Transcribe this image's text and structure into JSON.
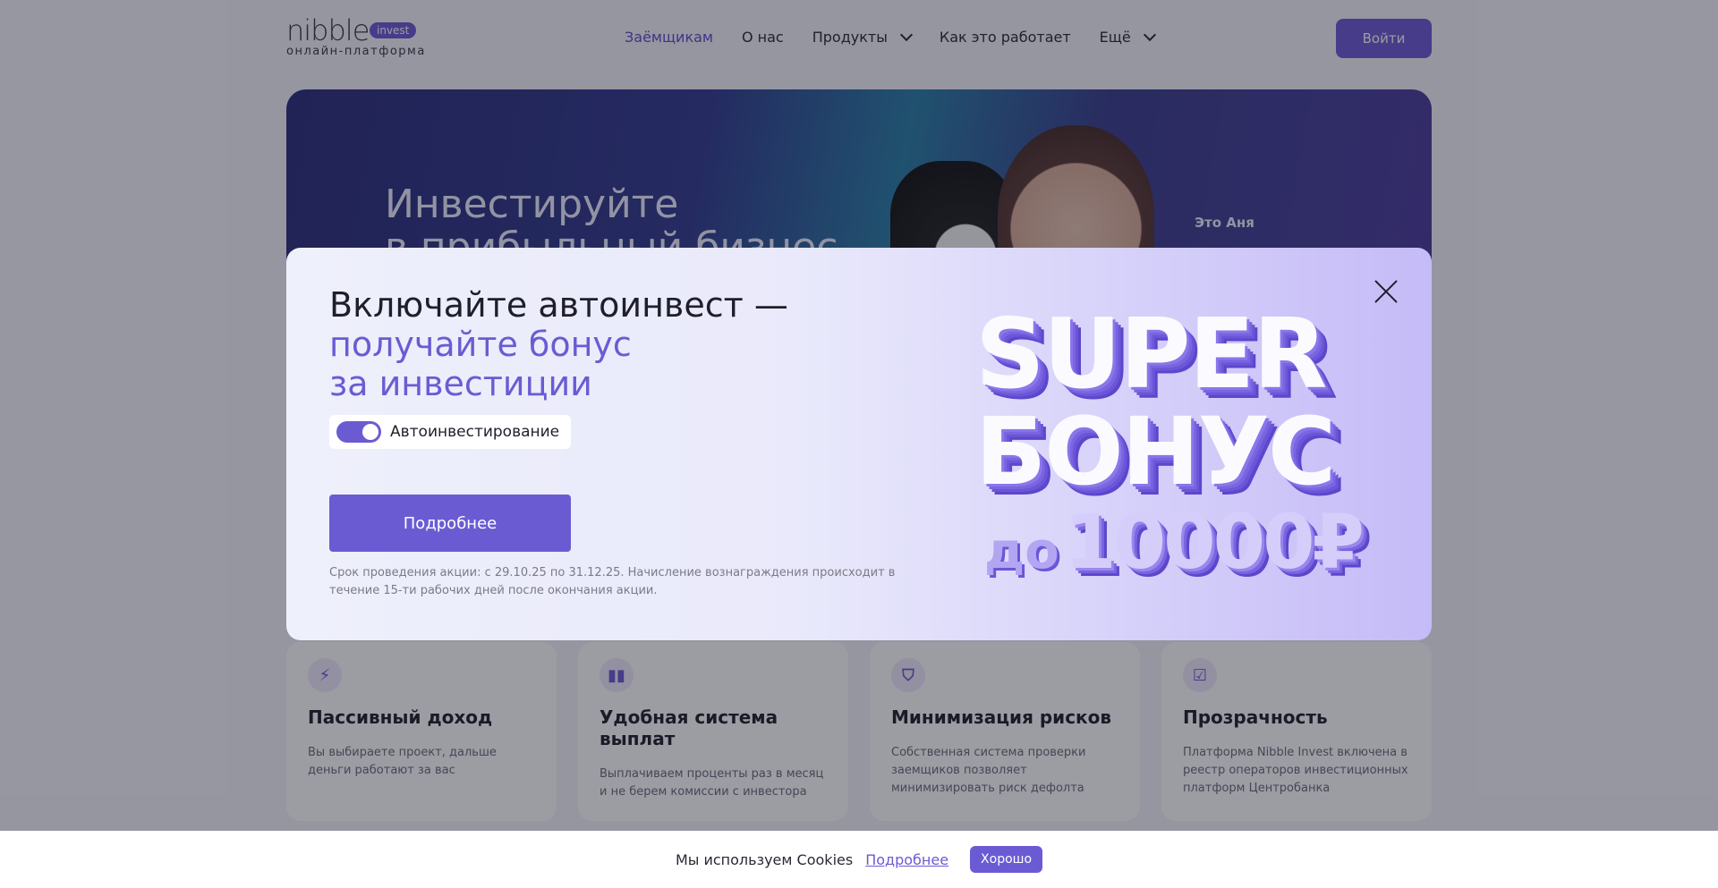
{
  "header": {
    "logo": {
      "word": "nibble",
      "badge": "invest",
      "sub": "онлайн-платформа"
    },
    "nav": [
      {
        "label": "Заёмщикам",
        "active": true,
        "dropdown": false
      },
      {
        "label": "О нас",
        "active": false,
        "dropdown": false
      },
      {
        "label": "Продукты",
        "active": false,
        "dropdown": true
      },
      {
        "label": "Как это работает",
        "active": false,
        "dropdown": false
      },
      {
        "label": "Ещё",
        "active": false,
        "dropdown": true
      }
    ],
    "login_label": "Войти"
  },
  "hero": {
    "title_line1": "Инвестируйте",
    "title_line2": "в прибыльный бизнес",
    "caption": "Это Аня"
  },
  "modal": {
    "title_line1": "Включайте автоинвест —",
    "title_line2": "получайте бонус",
    "title_line3": "за инвестиции",
    "toggle_label": "Автоинвестирование",
    "toggle_on": true,
    "button_label": "Подробнее",
    "note": "Срок проведения акции: с 29.10.25 по 31.12.25. Начисление вознаграждения происходит в течение 15-ти рабочих дней после окончания акции.",
    "promo": {
      "line1": "SUPER",
      "line2": "БОНУС",
      "prefix": "до",
      "amount": "10000₽"
    }
  },
  "features": [
    {
      "icon": "lightning-icon",
      "glyph": "⚡",
      "title": "Пассивный доход",
      "text": "Вы выбираете проект, дальше деньги работают за вас"
    },
    {
      "icon": "bar-chart-icon",
      "glyph": "▮▮",
      "title": "Удобная система выплат",
      "text": "Выплачиваем проценты раз в месяц и не берем комиссии с инвестора"
    },
    {
      "icon": "shield-icon",
      "glyph": "⛉",
      "title": "Минимизация рисков",
      "text": "Собственная система проверки заемщиков позволяет минимизировать риск дефолта"
    },
    {
      "icon": "check-square-icon",
      "glyph": "☑",
      "title": "Прозрачность",
      "text": "Платформа Nibble Invest включена в реестр операторов инвестиционных платформ Центробанка"
    }
  ],
  "cookie": {
    "text": "Мы используем Cookies",
    "link": "Подробнее",
    "ok_label": "Хорошо"
  },
  "colors": {
    "accent": "#6b5bd3",
    "accent_dark": "#5c4fc8"
  }
}
